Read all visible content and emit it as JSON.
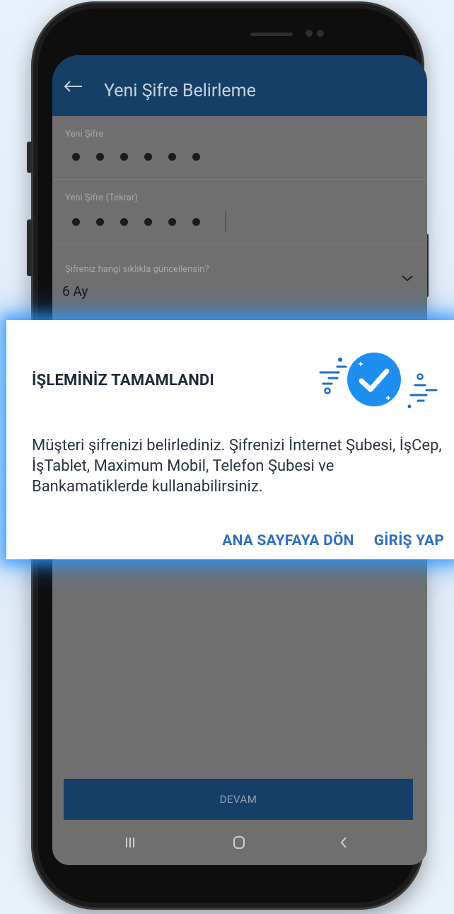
{
  "app_bar": {
    "title": "Yeni Şifre Belirleme"
  },
  "form": {
    "new_password_label": "Yeni Şifre",
    "new_password_repeat_label": "Yeni Şifre (Tekrar)",
    "update_frequency_label": "Şifreniz hangi sıklıkla güncellensin?",
    "update_frequency_value": "6 Ay",
    "continue_button": "DEVAM"
  },
  "dialog": {
    "title": "İŞLEMİNİZ TAMAMLANDI",
    "message": "Müşteri şifrenizi belirlediniz. Şifrenizi İnternet Şubesi, İşCep, İşTablet, Maximum Mobil, Telefon Şubesi ve Bankamatiklerde kullanabilirsiniz.",
    "actions": [
      {
        "label": "ANA SAYFAYA DÖN"
      },
      {
        "label": "GİRİŞ YAP"
      }
    ]
  },
  "icons": [
    "back-arrow-icon",
    "chevron-down-icon",
    "success-check-icon",
    "recent-apps-icon",
    "home-icon",
    "back-nav-icon"
  ],
  "colors": {
    "app_bar": "#163f67",
    "accent_blue": "#2f6fbd",
    "success_circle": "#1e8ff0",
    "dialog_glow": "#2896ff"
  }
}
